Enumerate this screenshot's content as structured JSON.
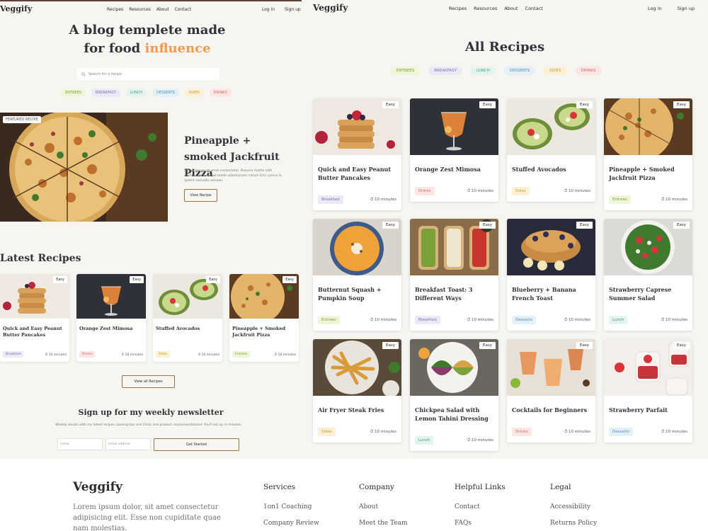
{
  "colors": {
    "accent_orange": "#f2994a",
    "button_border": "#9c7338",
    "background": "#f6f5f1",
    "entrees": "#eef6d8",
    "breakfast": "#ece9f7",
    "lunch": "#e3f4ef",
    "desserts": "#e4f0f8",
    "sides": "#fbf0d3",
    "drinks": "#fbe6e3"
  },
  "left": {
    "logo": "Veggify",
    "nav": [
      "Recipes",
      "Resources",
      "About",
      "Contact"
    ],
    "auth": [
      "Log in",
      "Sign up"
    ],
    "hero_line1": "A blog templete made",
    "hero_line2_prefix": "for food ",
    "hero_line2_accent": "influence",
    "search_placeholder": "Search for a recipe",
    "tags": [
      "ENTREES",
      "BREAKFAST",
      "LUNCH",
      "DESSERTS",
      "SIDES",
      "DRINKS"
    ],
    "featured": {
      "badge": "FEATURED RECIPE",
      "title": "Pineapple + smoked Jackfruit Pizza",
      "description": "Lorem ipsum sit amet consectetur. Posuere mattis nibh vestibulum euismod morbi ullamcorper rutrum.Orci cursus in aptent convallis aenean.",
      "button": "View Recipe"
    },
    "latest_title": "Latest Recipes",
    "latest_cards": [
      {
        "title": "Quick and Easy Peanut Butter Pancakes",
        "category": "Breakfast",
        "time": "10 minutes",
        "difficulty": "Easy"
      },
      {
        "title": "Orange Zest Mimosa",
        "category": "Drinks",
        "time": "10 minutes",
        "difficulty": "Easy"
      },
      {
        "title": "Stuffed Avocados",
        "category": "Sides",
        "time": "10 minutes",
        "difficulty": "Easy"
      },
      {
        "title": "Pineapple + Smoked Jackfruit Pizza",
        "category": "Entrees",
        "time": "10 minutes",
        "difficulty": "Easy"
      }
    ],
    "view_all": "View all Recipes",
    "newsletter": {
      "title": "Sign up for my weekly newsletter",
      "description": "Weekly emails with my latest recipes cooking tips and tricks and product recommendations! You'll set up in minutes.",
      "name_placeholder": "name",
      "email_placeholder": "email address",
      "button": "Get Started"
    }
  },
  "right": {
    "logo": "Veggify",
    "nav": [
      "Recipes",
      "Resources",
      "About",
      "Contact"
    ],
    "auth": [
      "Log in",
      "Sign up"
    ],
    "title": "All Recipes",
    "tags": [
      "ENTREES",
      "BREAKFAST",
      "LUNCH",
      "DESSERTS",
      "SIDES",
      "DRINKS"
    ],
    "cards": [
      {
        "title": "Quick and Easy Peanut Butter Pancakes",
        "category": "Breakfast",
        "time": "10 minutes",
        "difficulty": "Easy"
      },
      {
        "title": "Orange Zest Mimosa",
        "category": "Drinks",
        "time": "10 minutes",
        "difficulty": "Easy"
      },
      {
        "title": "Stuffed Avocados",
        "category": "Sides",
        "time": "10 minutes",
        "difficulty": "Easy"
      },
      {
        "title": "Pineapple + Smoked Jackfruit Pizza",
        "category": "Entrees",
        "time": "10 minutes",
        "difficulty": "Easy"
      },
      {
        "title": "Butternut Squash + Pumpkin Soup",
        "category": "Entrees",
        "time": "10 minutes",
        "difficulty": "Easy"
      },
      {
        "title": "Breakfast Toast: 3 Different Ways",
        "category": "Breakfast",
        "time": "10 minutes",
        "difficulty": "Easy"
      },
      {
        "title": "Blueberry + Banana French Toast",
        "category": "Desserts",
        "time": "10 minutes",
        "difficulty": "Easy"
      },
      {
        "title": "Strawberry Caprese Summer Salad",
        "category": "Lunch",
        "time": "10 minutes",
        "difficulty": "Easy"
      },
      {
        "title": "Air Fryer Steak Fries",
        "category": "Sides",
        "time": "10 minutes",
        "difficulty": "Easy"
      },
      {
        "title": "Chickpea Salad with Lemon Tahini Dressing",
        "category": "Lunch",
        "time": "10 minutes",
        "difficulty": "Easy"
      },
      {
        "title": "Cocktails for Beginners",
        "category": "Drinks",
        "time": "10 minutes",
        "difficulty": "Easy"
      },
      {
        "title": "Strawberry Parfait",
        "category": "Desserts",
        "time": "10 minutes",
        "difficulty": "Easy"
      }
    ]
  },
  "footer": {
    "logo": "Veggify",
    "description": "Lorem ipsum dolor, sit amet consectetur adipisicing elit. Esse non cupiditate quae nam molestias.",
    "columns": [
      {
        "title": "Services",
        "links": [
          "1on1 Coaching",
          "Company Review"
        ]
      },
      {
        "title": "Company",
        "links": [
          "About",
          "Meet the Team"
        ]
      },
      {
        "title": "Helpful Links",
        "links": [
          "Contact",
          "FAQs"
        ]
      },
      {
        "title": "Legal",
        "links": [
          "Accessibility",
          "Returns Policy"
        ]
      }
    ]
  }
}
